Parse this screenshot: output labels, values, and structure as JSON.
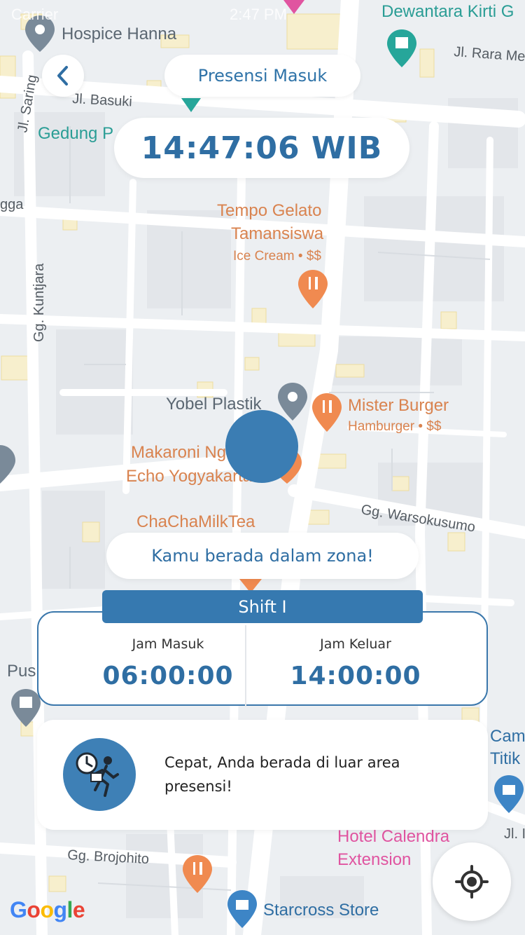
{
  "status_bar": {
    "carrier": "Carrier",
    "time": "2:47 PM"
  },
  "header": {
    "title": "Presensi Masuk",
    "clock": "14:47:06 WIB"
  },
  "map": {
    "streets": [
      "Jl. Basuki",
      "Jl. Saring",
      "Jl. Rara Me",
      "Gg. Kuntjara",
      "Gg. Warsokusumo",
      "Gg. Brojohito",
      "gga",
      "Jl. I"
    ],
    "places": {
      "hospice": "Hospice Hanna",
      "dewantara": "Dewantara Kirti G",
      "gedung": "Gedung P",
      "tempo": "Tempo Gelato",
      "tempo2": "Tamansiswa",
      "tempo_sub": "Ice Cream • $$",
      "yobel": "Yobel Plastik",
      "mister": "Mister Burger",
      "mister_sub": "Hamburger • $$",
      "makaroni": "Makaroni Ng",
      "makaroni2": "Echo Yogyakarta",
      "chacha": "ChaChaMilkTea",
      "pus": "Pus",
      "cam": "Cam",
      "titik": "Titik",
      "hotel": "Hotel Calendra",
      "hotel2": "Extension",
      "starcross": "Starcross Store"
    },
    "google": [
      "G",
      "o",
      "o",
      "g",
      "l",
      "e"
    ]
  },
  "zone_status": "Kamu berada dalam zona!",
  "shift": {
    "name": "Shift I",
    "jam_masuk_label": "Jam Masuk",
    "jam_masuk": "06:00:00",
    "jam_keluar_label": "Jam Keluar",
    "jam_keluar": "14:00:00"
  },
  "warning": {
    "text": "Cepat, Anda berada di luar area presensi!"
  },
  "colors": {
    "primary": "#3679b0",
    "text_blue": "#2f6ea3",
    "poi_orange": "#d9834f",
    "poi_gray": "#7a8a99",
    "poi_teal": "#26a69a",
    "poi_pink": "#e054a0"
  },
  "icons": [
    "chevron-left-icon",
    "clock-running-person-icon",
    "my-location-icon",
    "fork-knife-icon",
    "pin-icon",
    "museum-icon",
    "shopping-bag-icon"
  ]
}
